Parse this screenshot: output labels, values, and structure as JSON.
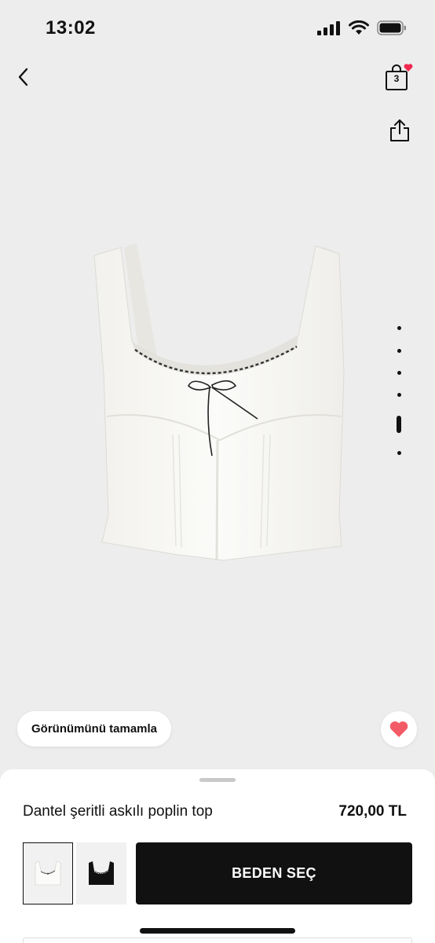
{
  "status_bar": {
    "time": "13:02",
    "icons": [
      "cellular-signal-icon",
      "wifi-icon",
      "battery-icon"
    ]
  },
  "nav": {
    "back_icon": "chevron-left-icon",
    "bag_icon": "shopping-bag-icon",
    "bag_count": "3",
    "bag_badge_color": "#f2284f",
    "share_icon": "share-icon"
  },
  "gallery": {
    "image_count": 6,
    "active_index": 4
  },
  "complete_look_label": "Görünümünü tamamla",
  "favorite_icon": "heart-icon",
  "favorite_color": "#f25b66",
  "product": {
    "name": "Dantel şeritli askılı poplin top",
    "price": "720,00 TL",
    "variants": [
      {
        "name": "white-variant",
        "color": "#f6f5f1",
        "selected": true
      },
      {
        "name": "black-variant",
        "color": "#111111",
        "selected": false
      }
    ]
  },
  "actions": {
    "select_size_label": "BEDEN SEÇ"
  }
}
